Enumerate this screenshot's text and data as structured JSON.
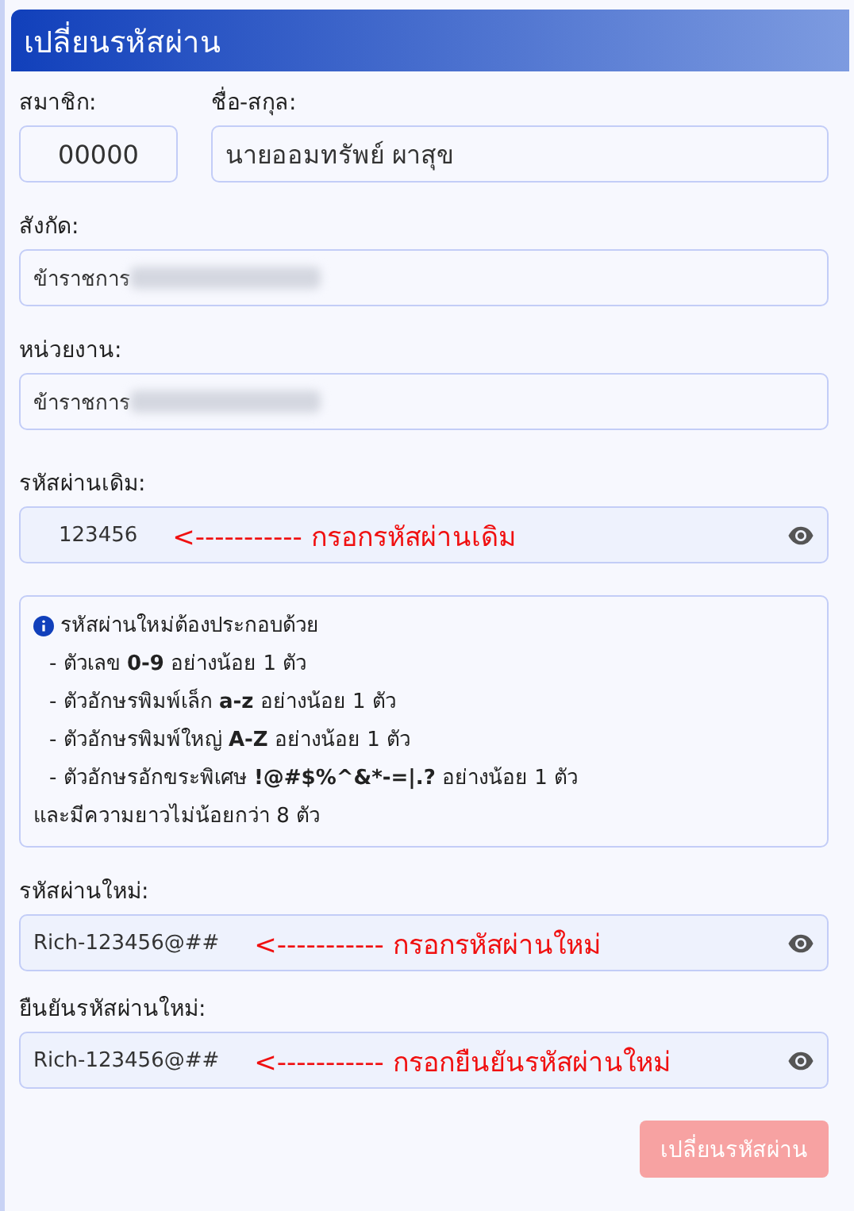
{
  "header": {
    "title": "เปลี่ยนรหัสผ่าน"
  },
  "member": {
    "label": "สมาชิก:",
    "value": "00000"
  },
  "full_name": {
    "label": "ชื่อ-สกุล:",
    "value": "นายออมทรัพย์ ผาสุข"
  },
  "affiliations": [
    {
      "label": "สังกัด:",
      "value": "ข้าราชการ",
      "redacted": true
    },
    {
      "label": "หน่วยงาน:",
      "value": "ข้าราชการ",
      "redacted": true
    }
  ],
  "old_password": {
    "label": "รหัสผ่านเดิม:",
    "value": "123456",
    "annotation": "<----------- กรอกรหัสผ่านเดิม"
  },
  "rules": {
    "heading": "รหัสผ่านใหม่ต้องประกอบด้วย",
    "items": [
      "- ตัวเลข **0-9** อย่างน้อย 1 ตัว",
      "- ตัวอักษรพิมพ์เล็ก **a-z** อย่างน้อย 1 ตัว",
      "- ตัวอักษรพิมพ์ใหญ่ **A-Z** อย่างน้อย 1 ตัว",
      "- ตัวอักษรอักขระพิเศษ **!@#$%^&*-=|.?** อย่างน้อย 1 ตัว"
    ],
    "footer": "และมีความยาวไม่น้อยกว่า 8 ตัว"
  },
  "new_passwords": [
    {
      "label": "รหัสผ่านใหม่:",
      "value": "Rich-123456@##",
      "annotation": "<----------- กรอกรหัสผ่านใหม่"
    },
    {
      "label": "ยืนยันรหัสผ่านใหม่:",
      "value": "Rich-123456@##",
      "annotation": "<----------- กรอกยืนยันรหัสผ่านใหม่"
    }
  ],
  "submit": {
    "label": "เปลี่ยนรหัสผ่าน",
    "disabled": true
  }
}
